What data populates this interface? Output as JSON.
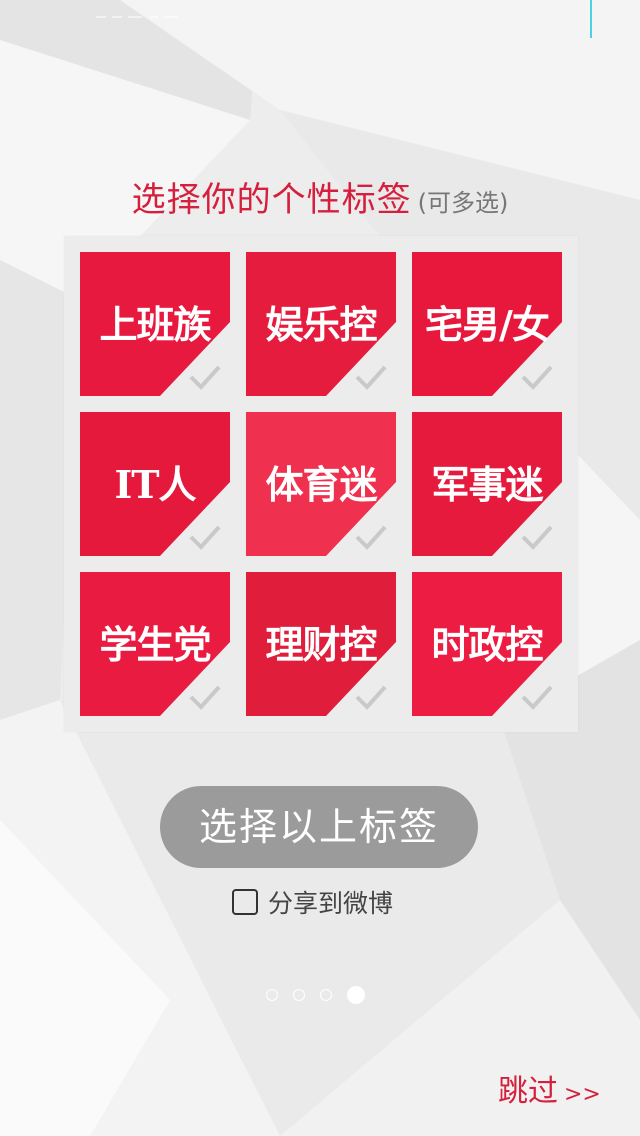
{
  "header": {
    "title": "选择你的个性标签",
    "subtitle": "(可多选)"
  },
  "tags": [
    {
      "label": "上班族",
      "selected": false,
      "color": "#e8193f"
    },
    {
      "label": "娱乐控",
      "selected": false,
      "color": "#e51c3e"
    },
    {
      "label": "宅男/女",
      "selected": false,
      "color": "#e8173c"
    },
    {
      "label": "IT人",
      "selected": false,
      "color": "#e4193c"
    },
    {
      "label": "体育迷",
      "selected": false,
      "color": "#f0304f"
    },
    {
      "label": "军事迷",
      "selected": false,
      "color": "#e51a3d"
    },
    {
      "label": "学生党",
      "selected": false,
      "color": "#e91b40"
    },
    {
      "label": "理财控",
      "selected": false,
      "color": "#e01d3b"
    },
    {
      "label": "时政控",
      "selected": false,
      "color": "#ec1c42"
    }
  ],
  "actions": {
    "select_button_label": "选择以上标签",
    "share_label": "分享到微博",
    "share_checked": false,
    "skip_label": "跳过",
    "skip_arrows": ">>"
  },
  "pager": {
    "total": 4,
    "current": 4
  },
  "colors": {
    "accent": "#d51f3c",
    "button_disabled": "#9b9b9b",
    "panel": "#ececec"
  }
}
